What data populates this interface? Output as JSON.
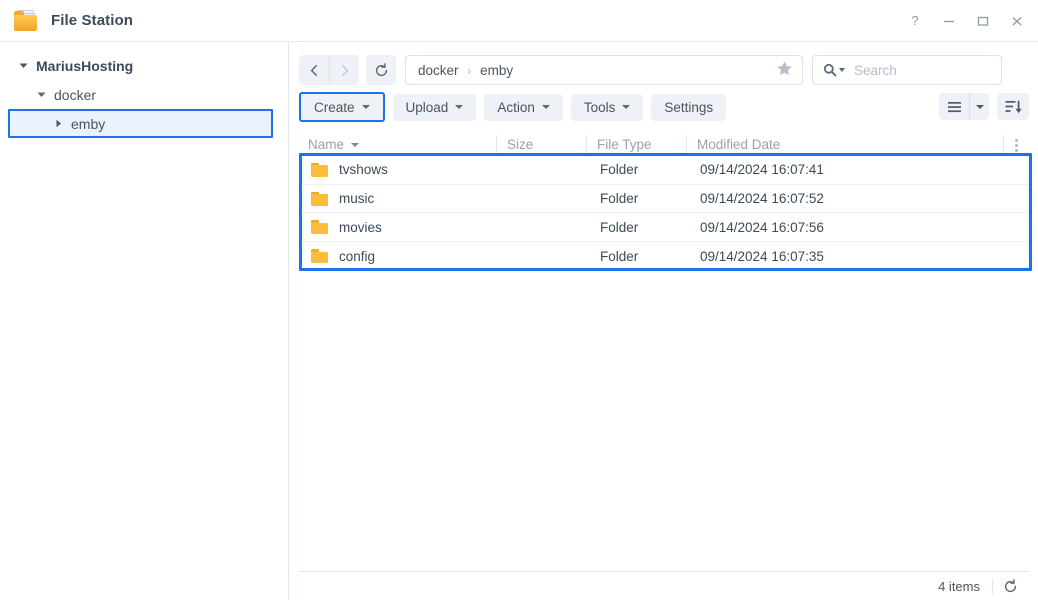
{
  "window": {
    "title": "File Station",
    "app_icon": "folder-icon",
    "controls": [
      {
        "name": "help-button",
        "glyph": "?"
      },
      {
        "name": "minimize-button",
        "glyph": "—"
      },
      {
        "name": "maximize-button",
        "glyph": "□"
      },
      {
        "name": "close-button",
        "glyph": "✕"
      }
    ]
  },
  "sidebar": {
    "items": [
      {
        "label": "MariusHosting",
        "level": 0,
        "expanded": true,
        "selected": false
      },
      {
        "label": "docker",
        "level": 1,
        "expanded": true,
        "selected": false
      },
      {
        "label": "emby",
        "level": 2,
        "expanded": false,
        "selected": true
      }
    ]
  },
  "nav": {
    "back_icon": "chevron-left-icon",
    "forward_icon": "chevron-right-icon",
    "refresh_icon": "refresh-icon",
    "breadcrumb": {
      "parts": [
        "docker",
        "emby"
      ],
      "separator": "›"
    },
    "favorite_icon": "star-icon"
  },
  "search": {
    "placeholder": "Search",
    "value": "",
    "icon": "search-icon"
  },
  "toolbar": {
    "buttons": [
      {
        "label": "Create",
        "caret": true,
        "highlighted": true,
        "name": "create-button"
      },
      {
        "label": "Upload",
        "caret": true,
        "highlighted": false,
        "name": "upload-button"
      },
      {
        "label": "Action",
        "caret": true,
        "highlighted": false,
        "name": "action-button"
      },
      {
        "label": "Tools",
        "caret": true,
        "highlighted": false,
        "name": "tools-button"
      },
      {
        "label": "Settings",
        "caret": false,
        "highlighted": false,
        "name": "settings-button"
      }
    ],
    "view_icon": "list-view-icon",
    "view_caret_icon": "chevron-down-icon",
    "sort_icon": "sort-descending-icon"
  },
  "table": {
    "columns": [
      {
        "label": "Name",
        "sorted": true
      },
      {
        "label": "Size",
        "sorted": false
      },
      {
        "label": "File Type",
        "sorted": false
      },
      {
        "label": "Modified Date",
        "sorted": false
      }
    ],
    "column_menu_icon": "more-options-icon",
    "rows": [
      {
        "icon": "folder-icon",
        "name": "tvshows",
        "size": "",
        "type": "Folder",
        "modified": "09/14/2024 16:07:41"
      },
      {
        "icon": "folder-icon",
        "name": "music",
        "size": "",
        "type": "Folder",
        "modified": "09/14/2024 16:07:52"
      },
      {
        "icon": "folder-icon",
        "name": "movies",
        "size": "",
        "type": "Folder",
        "modified": "09/14/2024 16:07:56"
      },
      {
        "icon": "folder-icon",
        "name": "config",
        "size": "",
        "type": "Folder",
        "modified": "09/14/2024 16:07:35"
      }
    ]
  },
  "status": {
    "count_label": "4 items",
    "refresh_icon": "refresh-icon"
  },
  "colors": {
    "accent": "#1a73e8",
    "folder": "#fcbc3c",
    "button_bg": "#eef1f5",
    "text": "#3d4a58",
    "muted": "#98a2ad",
    "selected_bg": "#e9f1fb"
  }
}
